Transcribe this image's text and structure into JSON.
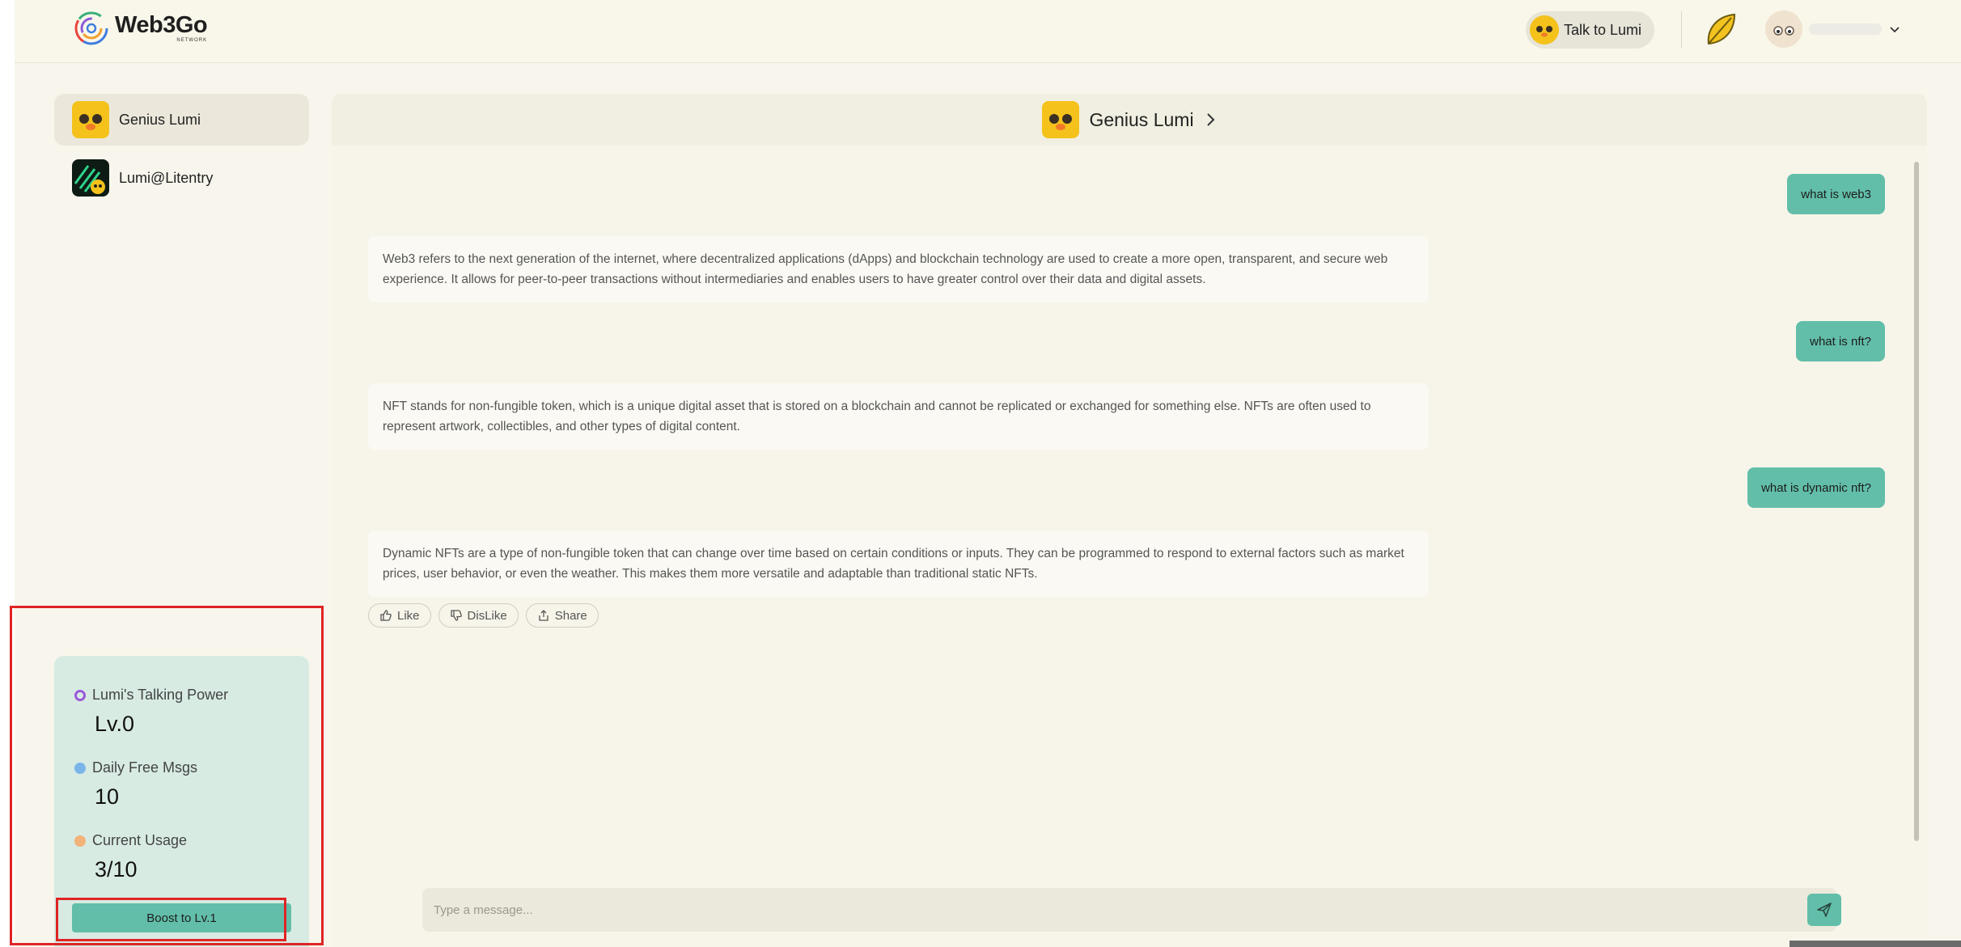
{
  "header": {
    "brand": "Web3Go",
    "brand_sub": "NETWORK",
    "talk_button": "Talk to Lumi"
  },
  "sidebar": {
    "items": [
      {
        "label": "Genius Lumi",
        "active": true
      },
      {
        "label": "Lumi@Litentry",
        "active": false
      }
    ],
    "stats": {
      "talking_power_label": "Lumi's Talking Power",
      "talking_power_value": "Lv.0",
      "daily_free_label": "Daily Free Msgs",
      "daily_free_value": "10",
      "usage_label": "Current Usage",
      "usage_value": "3/10",
      "boost_button": "Boost to Lv.1"
    }
  },
  "chat": {
    "title": "Genius Lumi",
    "messages": [
      {
        "role": "user",
        "text": "what is web3"
      },
      {
        "role": "bot",
        "text": "Web3 refers to the next generation of the internet, where decentralized applications (dApps) and blockchain technology are used to create a more open, transparent, and secure web experience. It allows for peer-to-peer transactions without intermediaries and enables users to have greater control over their data and digital assets."
      },
      {
        "role": "user",
        "text": "what is nft?"
      },
      {
        "role": "bot",
        "text": "NFT stands for non-fungible token, which is a unique digital asset that is stored on a blockchain and cannot be replicated or exchanged for something else. NFTs are often used to represent artwork, collectibles, and other types of digital content."
      },
      {
        "role": "user",
        "text": "what is dynamic nft?"
      },
      {
        "role": "bot",
        "text": "Dynamic NFTs are a type of non-fungible token that can change over time based on certain conditions or inputs. They can be programmed to respond to external factors such as market prices, user behavior, or even the weather. This makes them more versatile and adaptable than traditional static NFTs."
      }
    ],
    "actions": {
      "like": "Like",
      "dislike": "DisLike",
      "share": "Share"
    },
    "composer": {
      "placeholder": "Type a message...",
      "value": ""
    }
  },
  "colors": {
    "accent": "#62bea9",
    "page_bg": "#f8f6ec",
    "stats_bg": "#d7ebe3",
    "highlight": "#e02424"
  },
  "icons": [
    "web3go-logo-icon",
    "leaf-icon",
    "chevron-down-icon",
    "chevron-right-icon",
    "thumbs-up-icon",
    "thumbs-down-icon",
    "share-icon",
    "send-icon"
  ]
}
